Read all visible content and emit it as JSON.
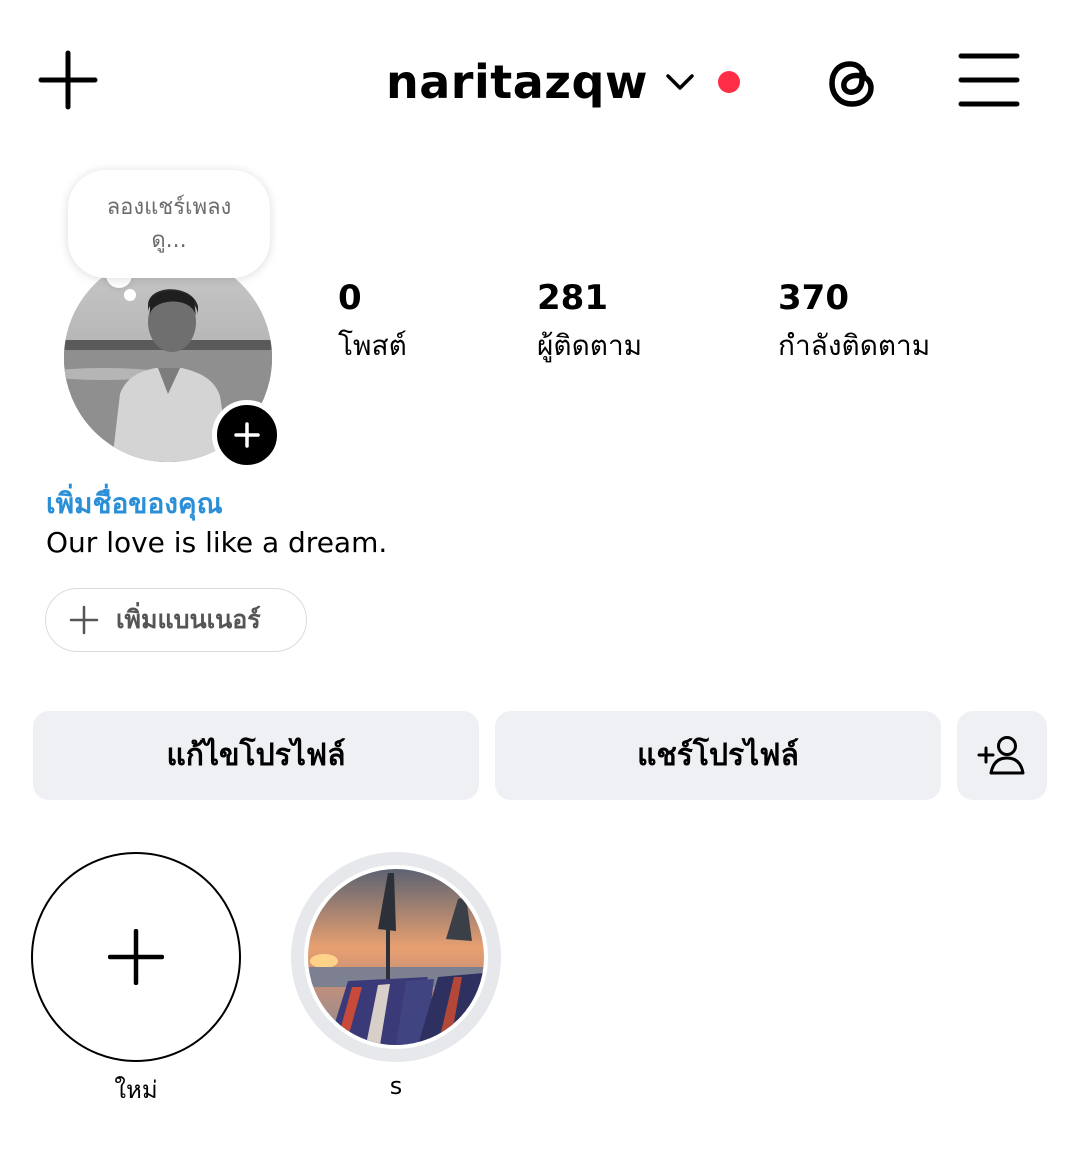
{
  "header": {
    "username": "naritazqw",
    "icons": {
      "create": "plus-icon",
      "account_switch": "chevron-down-icon",
      "threads": "threads-icon",
      "menu": "hamburger-menu-icon"
    },
    "notification_dot_color": "#ff2d46"
  },
  "note": {
    "line1": "ลองแชร์เพลง",
    "line2": "ดู..."
  },
  "stats": [
    {
      "value": "0",
      "label": "โพสต์"
    },
    {
      "value": "281",
      "label": "ผู้ติดตาม"
    },
    {
      "value": "370",
      "label": "กำลังติดตาม"
    }
  ],
  "profile": {
    "add_name_label": "เพิ่มชื่อของคุณ",
    "bio": "Our love is like a dream.",
    "add_banner_label": "เพิ่มแบนเนอร์",
    "accent_color": "#2b8fd8"
  },
  "actions": {
    "edit_profile": "แก้ไขโปรไฟล์",
    "share_profile": "แชร์โปรไฟล์",
    "discover_people_icon": "add-person-icon"
  },
  "highlights": [
    {
      "label": "ใหม่",
      "icon": "plus-icon"
    },
    {
      "label": "s"
    }
  ]
}
